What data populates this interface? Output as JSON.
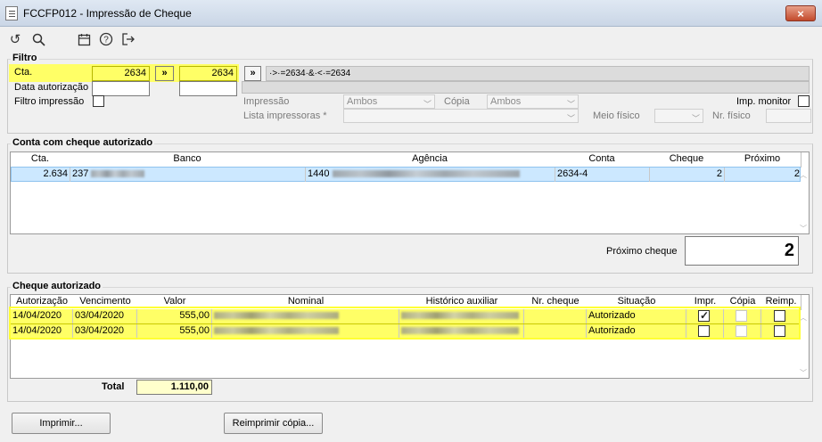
{
  "window": {
    "title": "FCCFP012 - Impressão de Cheque",
    "close_label": "×"
  },
  "toolbar": {
    "icons": [
      "undo-icon",
      "search-icon",
      "calendar-icon",
      "help-icon",
      "exit-icon"
    ]
  },
  "filtro": {
    "title": "Filtro",
    "cta_label": "Cta.",
    "cta_from": "2634",
    "cta_to": "2634",
    "arrow_btn": "»",
    "arrow_btn2": "»",
    "expression": "·>·=2634·&·<·=2634",
    "data_autorizacao_label": "Data autorização",
    "filtro_impressao_label": "Filtro impressão",
    "impressao_label": "Impressão",
    "impressao_value": "Ambos",
    "copia_label": "Cópia",
    "copia_value": "Ambos",
    "imp_monitor_label": "Imp. monitor",
    "lista_impressoras_label": "Lista impressoras *",
    "meio_fisico_label": "Meio físico",
    "nr_fisico_label": "Nr. físico"
  },
  "conta": {
    "title": "Conta com cheque autorizado",
    "columns": [
      "Cta.",
      "Banco",
      "Agência",
      "Conta",
      "Cheque",
      "Próximo"
    ],
    "rows": [
      {
        "cta": "2.634",
        "banco": "237",
        "agencia": "1440",
        "conta": "2634-4",
        "cheque": "2",
        "proximo": "2"
      }
    ],
    "proximo_cheque_label": "Próximo cheque",
    "proximo_cheque_value": "2"
  },
  "cheque": {
    "title": "Cheque autorizado",
    "columns": [
      "Autorização",
      "Vencimento",
      "Valor",
      "Nominal",
      "Histórico auxiliar",
      "Nr. cheque",
      "Situação",
      "Impr.",
      "Cópia",
      "Reimp."
    ],
    "rows": [
      {
        "autorizacao": "14/04/2020",
        "vencimento": "03/04/2020",
        "valor": "555,00",
        "nr_cheque": "",
        "situacao": "Autorizado",
        "impr": true,
        "copia": false,
        "reimp": false
      },
      {
        "autorizacao": "14/04/2020",
        "vencimento": "03/04/2020",
        "valor": "555,00",
        "nr_cheque": "",
        "situacao": "Autorizado",
        "impr": false,
        "copia": false,
        "reimp": false
      }
    ],
    "total_label": "Total",
    "total_value": "1.110,00"
  },
  "buttons": {
    "imprimir": "Imprimir...",
    "reimprimir": "Reimprimir cópia..."
  },
  "colors": {
    "highlight": "#ffff66",
    "selection": "#cce8ff"
  }
}
